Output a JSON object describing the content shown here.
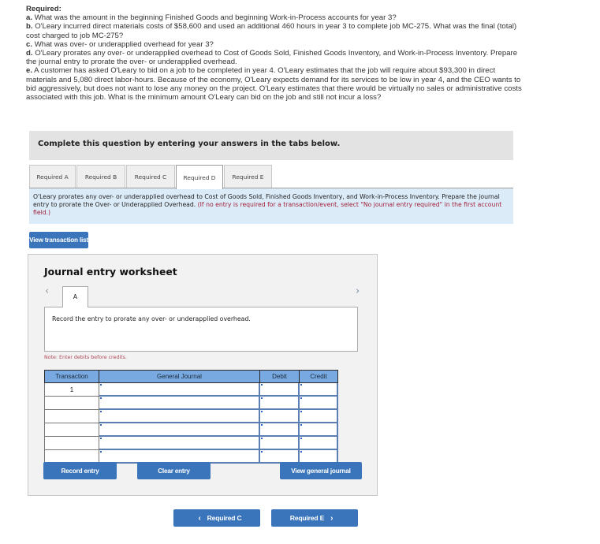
{
  "required": {
    "title": "Required:",
    "items": [
      {
        "letter": "a.",
        "text": "What was the amount in the beginning Finished Goods and beginning Work-in-Process accounts for year 3?"
      },
      {
        "letter": "b.",
        "text": "O'Leary incurred direct materials costs of $58,600 and used an additional 460 hours in year 3 to complete job MC-275. What was the final (total) cost charged to job MC-275?"
      },
      {
        "letter": "c.",
        "text": "What was over- or underapplied overhead for year 3?"
      },
      {
        "letter": "d.",
        "text": "O'Leary prorates any over- or underapplied overhead to Cost of Goods Sold, Finished Goods Inventory, and Work-in-Process Inventory. Prepare the journal entry to prorate the over- or underapplied overhead."
      },
      {
        "letter": "e.",
        "text": "A customer has asked O'Leary to bid on a job to be completed in year 4. O'Leary estimates that the job will require about $93,300 in direct materials and 5,080 direct labor-hours. Because of the economy, O'Leary expects demand for its services to be low in year 4, and the CEO wants to bid aggressively, but does not want to lose any money on the project. O'Leary estimates that there would be virtually no sales or administrative costs associated with this job. What is the minimum amount O'Leary can bid on the job and still not incur a loss?"
      }
    ]
  },
  "banner": "Complete this question by entering your answers in the tabs below.",
  "tabs": [
    {
      "label": "Required A",
      "active": false
    },
    {
      "label": "Required B",
      "active": false
    },
    {
      "label": "Required C",
      "active": false
    },
    {
      "label": "Required D",
      "active": true
    },
    {
      "label": "Required E",
      "active": false
    }
  ],
  "instructions": {
    "main": "O'Leary prorates any over- or underapplied overhead to Cost of Goods Sold, Finished Goods Inventory, and Work-in-Process Inventory. Prepare the journal entry to prorate the Over- or Underapplied Overhead.",
    "note": "(If no entry is required for a transaction/event, select \"No journal entry required\" in the first account field.)"
  },
  "view_transaction_list": "View transaction list",
  "worksheet": {
    "title": "Journal entry worksheet",
    "prev_icon": "‹",
    "next_icon": "›",
    "entry_tab": "A",
    "entry_description": "Record the entry to prorate any over- or underapplied overhead.",
    "note": "Note: Enter debits before credits.",
    "columns": [
      "Transaction",
      "General Journal",
      "Debit",
      "Credit"
    ],
    "rows": [
      {
        "transaction": "1",
        "account": "",
        "debit": "",
        "credit": ""
      },
      {
        "transaction": "",
        "account": "",
        "debit": "",
        "credit": ""
      },
      {
        "transaction": "",
        "account": "",
        "debit": "",
        "credit": ""
      },
      {
        "transaction": "",
        "account": "",
        "debit": "",
        "credit": ""
      },
      {
        "transaction": "",
        "account": "",
        "debit": "",
        "credit": ""
      },
      {
        "transaction": "",
        "account": "",
        "debit": "",
        "credit": ""
      }
    ],
    "buttons": {
      "record": "Record entry",
      "clear": "Clear entry",
      "view_journal": "View general journal"
    }
  },
  "navigation": {
    "prev_label": "Required C",
    "next_label": "Required E",
    "prev_icon": "‹",
    "next_icon": "›"
  },
  "colors": {
    "button_blue": "#3a75bb",
    "table_header": "#78a9e0",
    "instruction_bg": "#dcebf8",
    "note_red": "#a0203a"
  }
}
